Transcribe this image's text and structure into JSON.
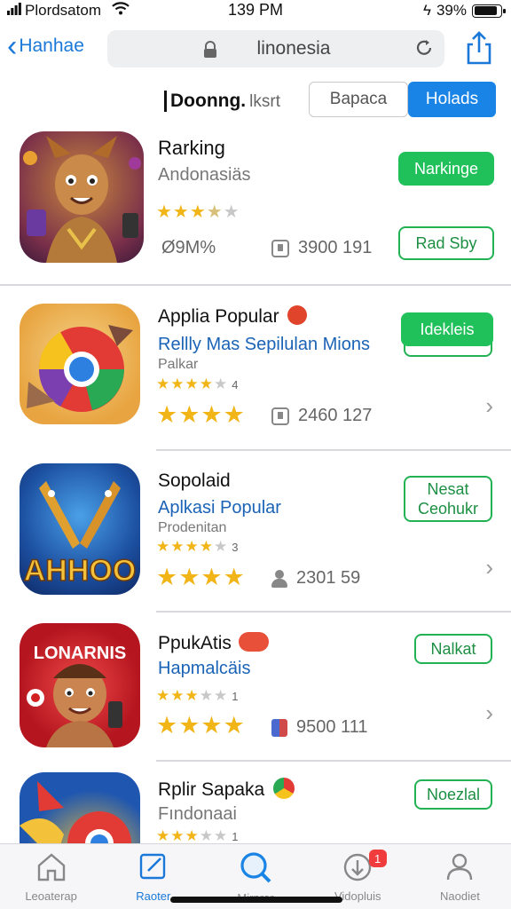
{
  "status": {
    "carrier": "Plordsatom",
    "time": "139 PM",
    "battery": "39%",
    "battery_level": 0.88
  },
  "nav": {
    "back_label": "Hanhae",
    "url": "linonesia",
    "icons": {
      "lock": "lock-icon",
      "reload": "reload-icon",
      "share": "share-icon"
    }
  },
  "header": {
    "title": "Doonng.",
    "title_suffix": "lksrt",
    "seg_off": "Bapaca",
    "seg_on": "Holads"
  },
  "apps": [
    {
      "name": "Rarking",
      "subtitle": "Andonasiäs",
      "rating": 3.5,
      "size": "Ø9M%",
      "downloads": "3900 191",
      "button_primary": "Narkinge",
      "button_secondary": "Rad Sby"
    },
    {
      "name": "Applia Popular",
      "subtitle": "Rellly Mas Sepilulan Mions",
      "category": "Palkar",
      "rating_count": "4",
      "downloads": "2460 127",
      "button_primary": "Idekleis"
    },
    {
      "name": "Sopolaid",
      "subtitle": "Aplkasi Popular",
      "category": "Prodenitan",
      "rating_count": "3",
      "downloads": "2301 59",
      "button_secondary_line1": "Nesat",
      "button_secondary_line2": "Ceohukr",
      "icon_text": "AHHOO"
    },
    {
      "name": "PpukAtis",
      "subtitle": "Hapmalcäis",
      "rating_count": "1",
      "downloads": "9500 111",
      "button_secondary": "Nalkat",
      "icon_text": "LONARNIS"
    },
    {
      "name": "Rplir Sapaka",
      "subtitle": "Fındonaai",
      "rating_count": "1",
      "button_secondary": "Noezlal"
    }
  ],
  "tabs": [
    {
      "label": "Leoaterap",
      "icon": "home-icon"
    },
    {
      "label": "Raoter",
      "icon": "edit-icon"
    },
    {
      "label": "Mirnrer",
      "icon": "search-icon"
    },
    {
      "label": "Vidopluis",
      "icon": "updates-icon",
      "badge": "1"
    },
    {
      "label": "Naodiet",
      "icon": "person-icon"
    }
  ],
  "colors": {
    "accent_blue": "#1a78d8",
    "green": "#20c15a",
    "star": "#f2b518",
    "badge_red": "#f03c3c"
  }
}
